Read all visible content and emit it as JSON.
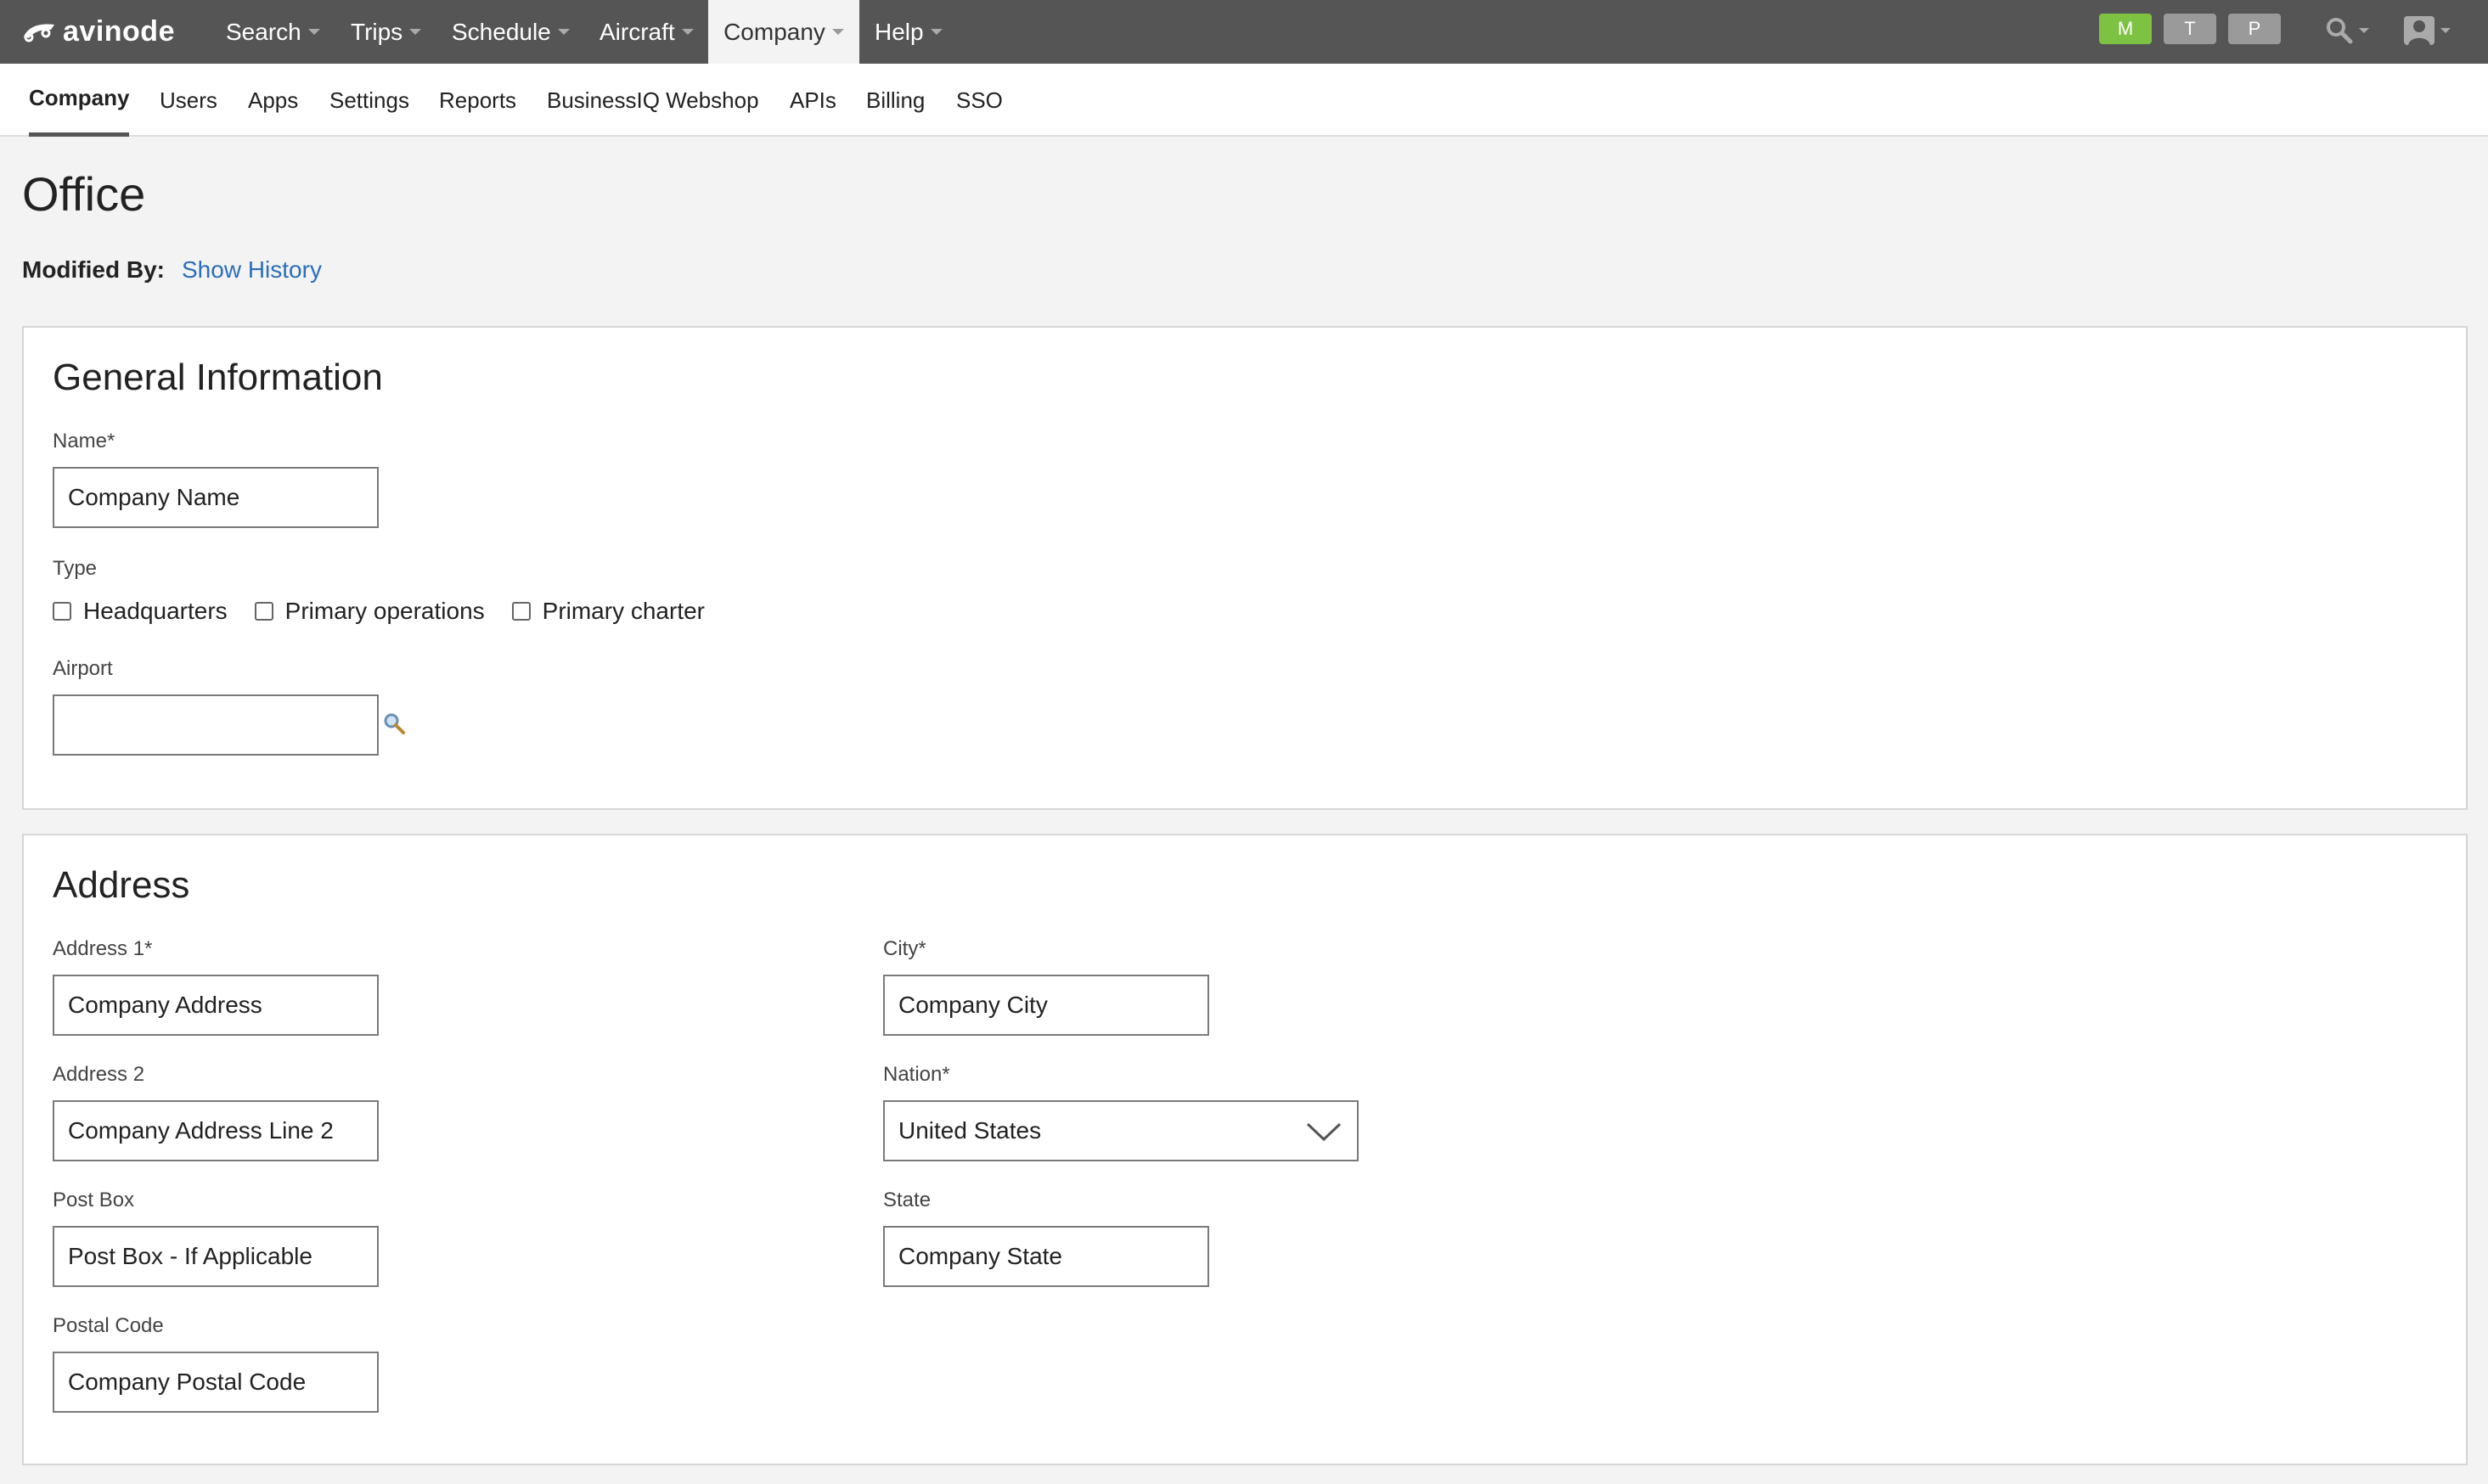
{
  "app": {
    "brand": "avinode"
  },
  "topnav": {
    "items": [
      {
        "label": "Search"
      },
      {
        "label": "Trips"
      },
      {
        "label": "Schedule"
      },
      {
        "label": "Aircraft"
      },
      {
        "label": "Company"
      },
      {
        "label": "Help"
      }
    ],
    "active": "Company",
    "badges": [
      {
        "label": "M",
        "color": "#7dc242"
      },
      {
        "label": "T",
        "color": "#9a9a9a"
      },
      {
        "label": "P",
        "color": "#9a9a9a"
      }
    ],
    "icons": [
      "search-icon",
      "user-icon"
    ]
  },
  "subnav": {
    "items": [
      {
        "label": "Company"
      },
      {
        "label": "Users"
      },
      {
        "label": "Apps"
      },
      {
        "label": "Settings"
      },
      {
        "label": "Reports"
      },
      {
        "label": "BusinessIQ Webshop"
      },
      {
        "label": "APIs"
      },
      {
        "label": "Billing"
      },
      {
        "label": "SSO"
      }
    ],
    "active": "Company"
  },
  "page": {
    "title": "Office",
    "modified_label": "Modified By:",
    "show_history": "Show History"
  },
  "general": {
    "title": "General Information",
    "name_label": "Name*",
    "name_value": "Company Name",
    "type_label": "Type",
    "types": [
      {
        "label": "Headquarters",
        "checked": false
      },
      {
        "label": "Primary operations",
        "checked": false
      },
      {
        "label": "Primary charter",
        "checked": false
      }
    ],
    "airport_label": "Airport",
    "airport_value": ""
  },
  "address": {
    "title": "Address",
    "address1_label": "Address 1*",
    "address1_value": "Company Address",
    "address2_label": "Address 2",
    "address2_value": "Company Address Line 2",
    "postbox_label": "Post Box",
    "postbox_value": "Post Box - If Applicable",
    "postal_label": "Postal Code",
    "postal_value": "Company Postal Code",
    "city_label": "City*",
    "city_value": "Company City",
    "nation_label": "Nation*",
    "nation_value": "United States",
    "state_label": "State",
    "state_value": "Company State"
  }
}
